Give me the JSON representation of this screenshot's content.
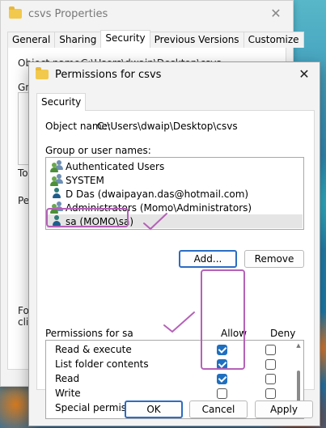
{
  "properties_window": {
    "title": "csvs Properties",
    "tabs": [
      "General",
      "Sharing",
      "Security",
      "Previous Versions",
      "Customize"
    ],
    "active_tab": "Security",
    "partial_texts": {
      "object_name": "Object name:",
      "object_path": "C:\\Users\\dwaip\\Desktop\\csvs",
      "group": "Gr",
      "to_change": "To",
      "permissions": "Pe",
      "for_special": "For",
      "click": "clic"
    }
  },
  "dialog": {
    "title": "Permissions for csvs",
    "tab": "Security",
    "object_name_label": "Object name:",
    "object_name_value": "C:\\Users\\dwaip\\Desktop\\csvs",
    "group_label": "Group or user names:",
    "users": [
      {
        "label": "Authenticated Users",
        "icon": "group-users-icon"
      },
      {
        "label": "SYSTEM",
        "icon": "group-users-icon"
      },
      {
        "label": "D Das (dwaipayan.das@hotmail.com)",
        "icon": "user-icon"
      },
      {
        "label": "Administrators (Momo\\Administrators)",
        "icon": "group-users-icon"
      },
      {
        "label": "sa (MOMO\\sa)",
        "icon": "user-icon",
        "selected": true
      }
    ],
    "add_button": "Add...",
    "remove_button": "Remove",
    "permissions_label": "Permissions for sa",
    "allow_label": "Allow",
    "deny_label": "Deny",
    "permissions": [
      {
        "name": "Read & execute",
        "allow": true,
        "deny": false
      },
      {
        "name": "List folder contents",
        "allow": true,
        "deny": false
      },
      {
        "name": "Read",
        "allow": true,
        "deny": false
      },
      {
        "name": "Write",
        "allow": false,
        "deny": false
      },
      {
        "name": "Special permissions",
        "allow": false,
        "deny": false,
        "disabled": true
      }
    ],
    "ok_button": "OK",
    "cancel_button": "Cancel",
    "apply_button": "Apply"
  },
  "colors": {
    "accent": "#1f6fbf",
    "annotation": "#b561b8",
    "folder": "#f2c94c"
  }
}
